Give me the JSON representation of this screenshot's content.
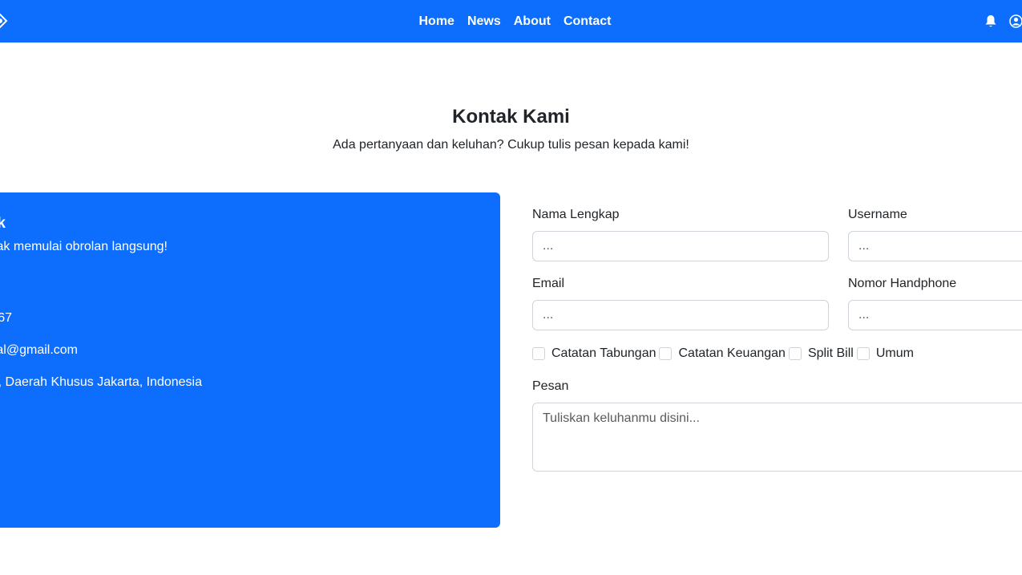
{
  "navbar": {
    "links": [
      "Home",
      "News",
      "About",
      "Contact"
    ],
    "bg_color": "#0d6efd",
    "icons": [
      "logo-icon",
      "bell-icon",
      "user-icon"
    ]
  },
  "header": {
    "title": "Kontak Kami",
    "subtitle": "Ada pertanyaan dan keluhan? Cukup tulis pesan kepada kami!"
  },
  "info_card": {
    "title": "k",
    "intro": "ak memulai obrolan langsung!",
    "phone": "67",
    "email": "al@gmail.com",
    "address": "at, Daerah Khusus Jakarta, Indonesia",
    "bg_color": "#0d6efd"
  },
  "form": {
    "fields": [
      {
        "label": "Nama Lengkap",
        "placeholder": "..."
      },
      {
        "label": "Username",
        "placeholder": "..."
      },
      {
        "label": "Email",
        "placeholder": "..."
      },
      {
        "label": "Nomor Handphone",
        "placeholder": "..."
      }
    ],
    "checkboxes": [
      "Catatan Tabungan",
      "Catatan Keuangan",
      "Split Bill",
      "Umum"
    ],
    "message": {
      "label": "Pesan",
      "placeholder": "Tuliskan keluhanmu disini..."
    }
  }
}
